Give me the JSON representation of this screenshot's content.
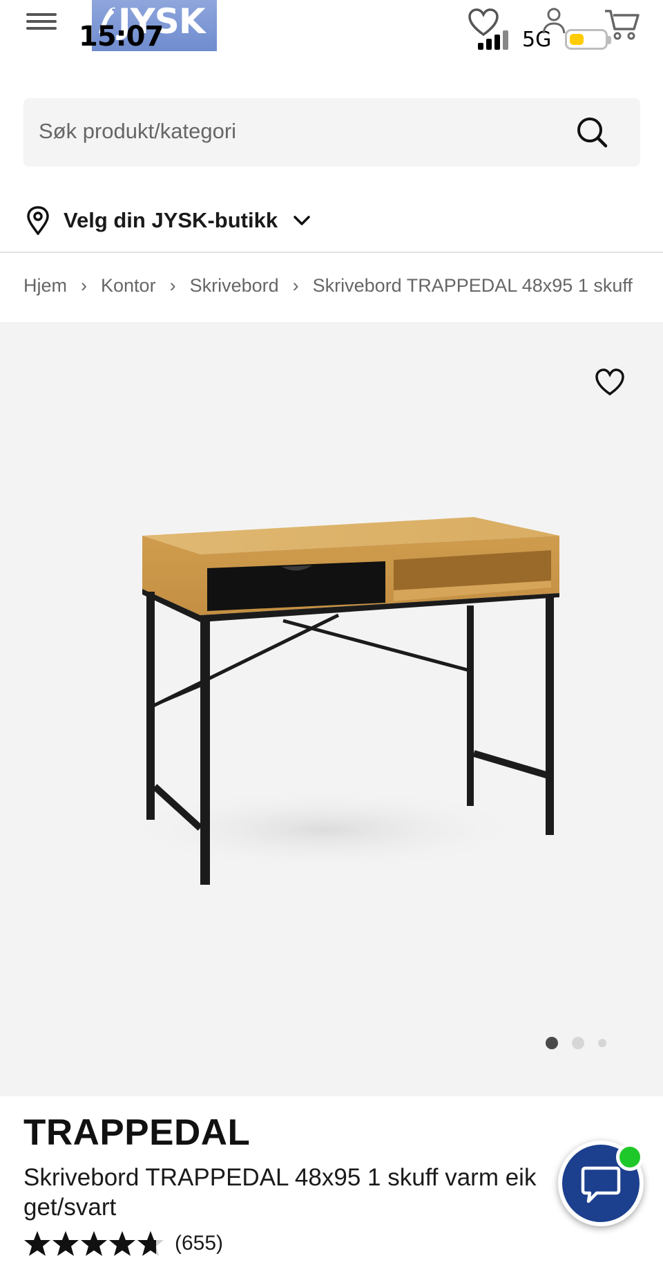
{
  "header": {
    "logo_text": "JYSK",
    "status_time": "15:07",
    "network": "5G",
    "brand_color": "#6f8ccf",
    "battery_color": "#ffcc00"
  },
  "search": {
    "placeholder": "Søk produkt/kategori"
  },
  "store": {
    "label": "Velg din JYSK-butikk"
  },
  "breadcrumb": [
    "Hjem",
    "Kontor",
    "Skrivebord",
    "Skrivebord TRAPPEDAL 48x95 1 skuff"
  ],
  "gallery": {
    "active_index": 0,
    "image_count": 3,
    "background": "#f3f3f3"
  },
  "product": {
    "brand": "TRAPPEDAL",
    "title": "Skrivebord TRAPPEDAL 48x95 1 skuff varm eik get/svart",
    "rating_value": 4.7,
    "rating_max": 5,
    "review_count": "(655)"
  },
  "chat": {
    "accent": "#1c3f8e",
    "online_color": "#1fc82a"
  }
}
